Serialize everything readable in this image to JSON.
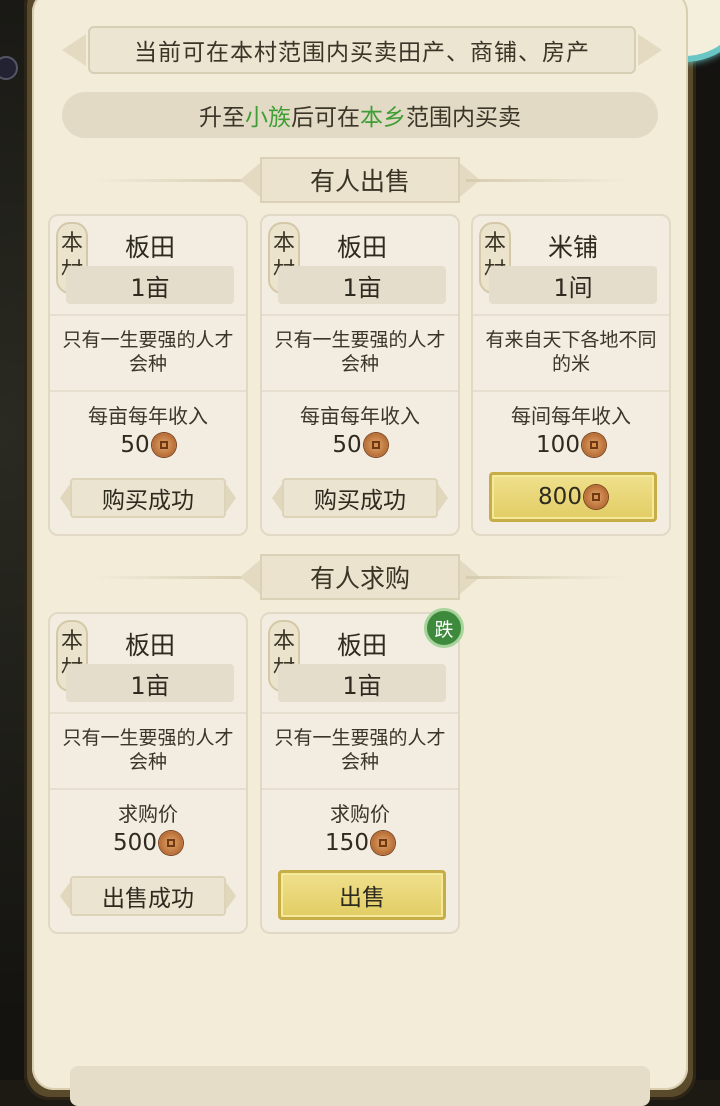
{
  "notice": "当前可在本村范围内买卖田产、商铺、房产",
  "hint": {
    "part1": "升至",
    "highlight1": "小族",
    "part2": "后可在",
    "highlight2": "本乡",
    "part3": "范围内买卖",
    "highlight_color": "#3f9e35"
  },
  "sections": {
    "selling_title": "有人出售",
    "buying_title": "有人求购"
  },
  "selling": [
    {
      "tag_top": "本",
      "tag_bottom": "村",
      "name": "板田",
      "unit": "1亩",
      "desc": "只有一生要强的人才会种",
      "price_label": "每亩每年收入",
      "price": "50",
      "button": "购买成功",
      "button_state": "done"
    },
    {
      "tag_top": "本",
      "tag_bottom": "村",
      "name": "板田",
      "unit": "1亩",
      "desc": "只有一生要强的人才会种",
      "price_label": "每亩每年收入",
      "price": "50",
      "button": "购买成功",
      "button_state": "done"
    },
    {
      "tag_top": "本",
      "tag_bottom": "村",
      "name": "米铺",
      "unit": "1间",
      "desc": "有来自天下各地不同的米",
      "price_label": "每间每年收入",
      "price": "100",
      "button": "800",
      "button_state": "buy"
    }
  ],
  "buying": [
    {
      "tag_top": "本",
      "tag_bottom": "村",
      "name": "板田",
      "unit": "1亩",
      "desc": "只有一生要强的人才会种",
      "price_label": "求购价",
      "price": "500",
      "button": "出售成功",
      "button_state": "done"
    },
    {
      "tag_top": "本",
      "tag_bottom": "村",
      "name": "板田",
      "unit": "1亩",
      "desc": "只有一生要强的人才会种",
      "price_label": "求购价",
      "price": "150",
      "button": "出售",
      "button_state": "sell",
      "badge": "跌"
    }
  ],
  "icons": {
    "coin": "copper-coin-icon"
  },
  "colors": {
    "panel": "#f2ecd9",
    "gold_button": "#e8d676",
    "badge_green": "#3d8a3d"
  }
}
